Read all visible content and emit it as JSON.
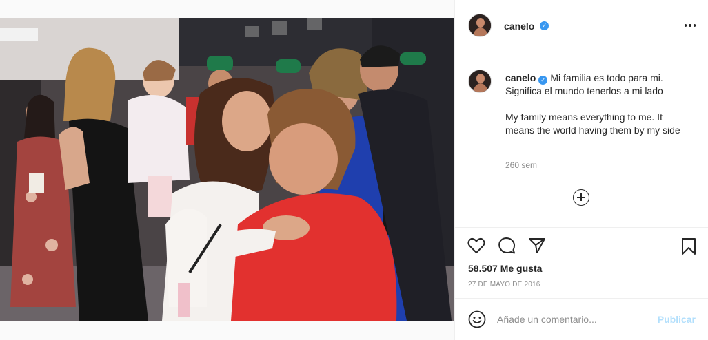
{
  "post": {
    "image_alt": "Canelo kissing his daughter backstage with family around",
    "author": {
      "username": "canelo",
      "verified": true
    }
  },
  "caption": {
    "username": "canelo",
    "line_es_1": "Mi familia es todo para mi.",
    "line_es_2": "Significa el mundo tenerlos a mi lado",
    "line_en": "My family means everything to me. It means the world having them by my side",
    "time_ago": "260 sem"
  },
  "actions": {
    "likes_count": "58.507",
    "likes_label": "Me gusta",
    "date": "27 DE MAYO DE 2016"
  },
  "comment": {
    "placeholder": "Añade un comentario...",
    "publish_label": "Publicar"
  },
  "colors": {
    "verified_blue": "#3897f0",
    "publish_disabled": "#b2dffc",
    "shirt_red": "#e2312f",
    "dress_blue": "#1f3fae"
  },
  "icons": [
    "more-options-icon",
    "verified-badge-icon",
    "add-comment-icon",
    "heart-icon",
    "comment-icon",
    "share-icon",
    "bookmark-icon",
    "emoji-icon"
  ]
}
